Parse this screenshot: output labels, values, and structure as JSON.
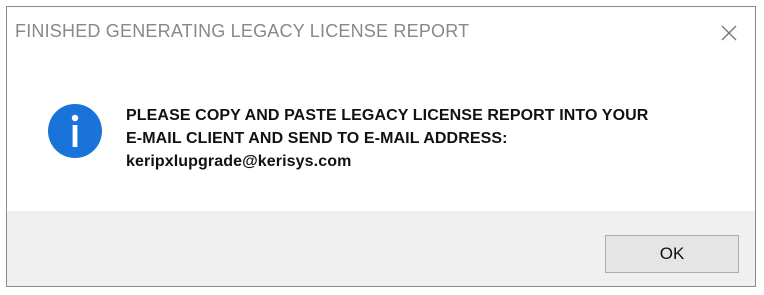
{
  "dialog": {
    "title": "FINISHED GENERATING LEGACY LICENSE REPORT",
    "close_icon": "close-icon",
    "icon": "info-icon",
    "message_lines": [
      "PLEASE COPY AND PASTE LEGACY LICENSE REPORT INTO YOUR",
      "E-MAIL CLIENT AND SEND TO E-MAIL ADDRESS:",
      "keripxlupgrade@kerisys.com"
    ],
    "ok_label": "OK"
  },
  "colors": {
    "info_icon_fill": "#1a73d9",
    "title_text": "#888888",
    "footer_bg": "#f0f0f0"
  }
}
